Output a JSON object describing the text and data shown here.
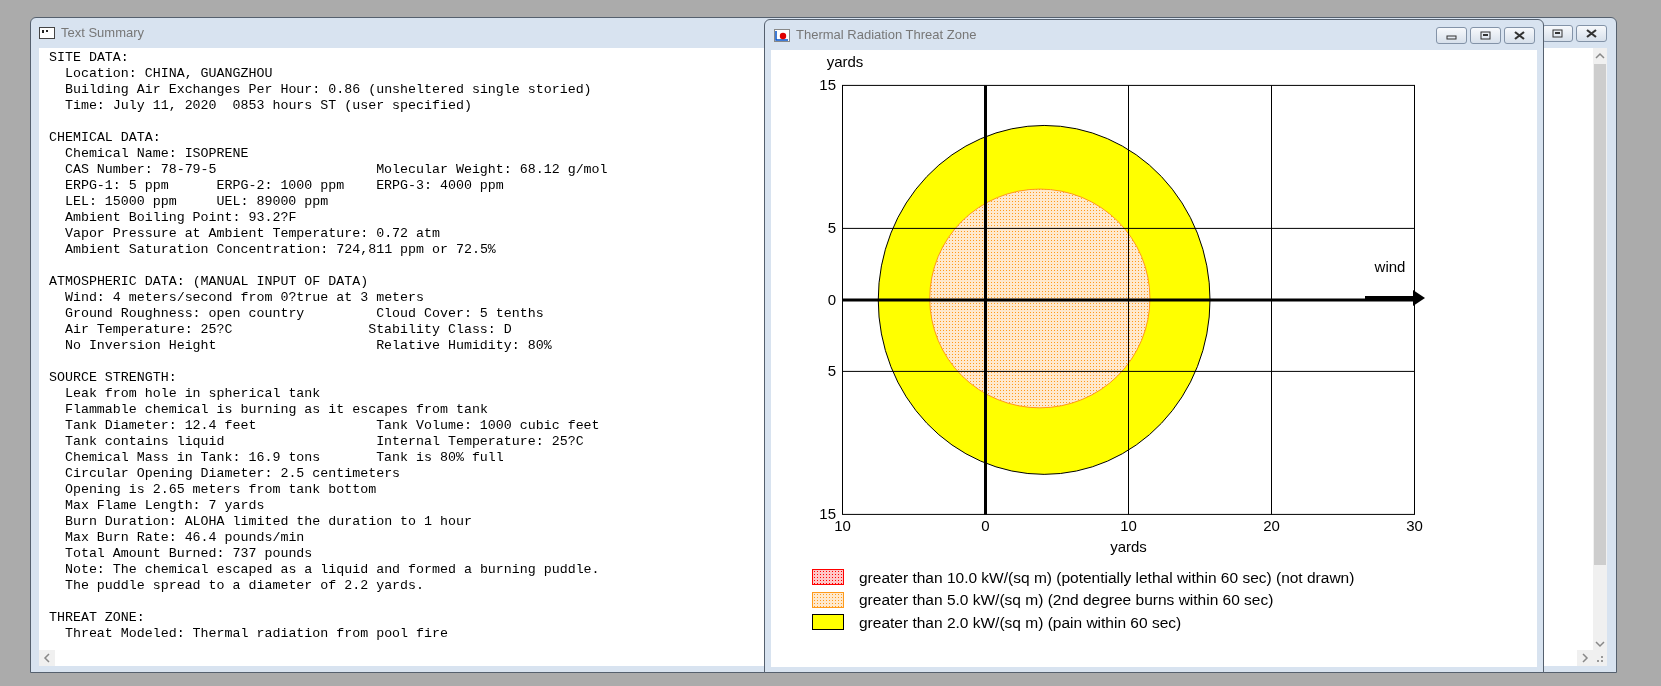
{
  "summary_window": {
    "title": "Text Summary",
    "sections": [
      {
        "heading": "SITE DATA:",
        "lines": [
          {
            "kind": "single",
            "texts": [
              "Location: CHINA, GUANGZHOU"
            ]
          },
          {
            "kind": "single",
            "texts": [
              "Building Air Exchanges Per Hour: 0.86 (unsheltered single storied)"
            ]
          },
          {
            "kind": "single",
            "texts": [
              "Time: July 11, 2020  0853 hours ST (user specified)"
            ]
          }
        ]
      },
      {
        "heading": "CHEMICAL DATA:",
        "lines": [
          {
            "kind": "single",
            "texts": [
              "Chemical Name: ISOPRENE"
            ]
          },
          {
            "kind": "pair",
            "texts": [
              "CAS Number: 78-79-5",
              "Molecular Weight: 68.12 g/mol"
            ]
          },
          {
            "kind": "triple",
            "texts": [
              "ERPG-1: 5 ppm",
              "ERPG-2: 1000 ppm",
              "ERPG-3: 4000 ppm"
            ]
          },
          {
            "kind": "triple",
            "texts": [
              "LEL: 15000 ppm",
              "UEL: 89000 ppm"
            ]
          },
          {
            "kind": "single",
            "texts": [
              "Ambient Boiling Point: 93.2?F"
            ]
          },
          {
            "kind": "single",
            "texts": [
              "Vapor Pressure at Ambient Temperature: 0.72 atm"
            ]
          },
          {
            "kind": "single",
            "texts": [
              "Ambient Saturation Concentration: 724,811 ppm or 72.5%"
            ]
          }
        ]
      },
      {
        "heading": "ATMOSPHERIC DATA: (MANUAL INPUT OF DATA)",
        "lines": [
          {
            "kind": "single",
            "texts": [
              "Wind: 4 meters/second from 0?true at 3 meters"
            ]
          },
          {
            "kind": "pair",
            "texts": [
              "Ground Roughness: open country",
              "Cloud Cover: 5 tenths"
            ]
          },
          {
            "kind": "pair_short",
            "texts": [
              "Air Temperature: 25?C",
              "Stability Class: D"
            ]
          },
          {
            "kind": "pair",
            "texts": [
              "No Inversion Height",
              "Relative Humidity: 80%"
            ]
          }
        ]
      },
      {
        "heading": "SOURCE STRENGTH:",
        "lines": [
          {
            "kind": "single",
            "texts": [
              "Leak from hole in spherical tank"
            ]
          },
          {
            "kind": "single",
            "texts": [
              "Flammable chemical is burning as it escapes from tank"
            ]
          },
          {
            "kind": "pair",
            "texts": [
              "Tank Diameter: 12.4 feet",
              "Tank Volume: 1000 cubic feet"
            ]
          },
          {
            "kind": "pair",
            "texts": [
              "Tank contains liquid",
              "Internal Temperature: 25?C"
            ]
          },
          {
            "kind": "pair",
            "texts": [
              "Chemical Mass in Tank: 16.9 tons",
              "Tank is 80% full"
            ]
          },
          {
            "kind": "single",
            "texts": [
              "Circular Opening Diameter: 2.5 centimeters"
            ]
          },
          {
            "kind": "single",
            "texts": [
              "Opening is 2.65 meters from tank bottom"
            ]
          },
          {
            "kind": "single",
            "texts": [
              "Max Flame Length: 7 yards"
            ]
          },
          {
            "kind": "single",
            "texts": [
              "Burn Duration: ALOHA limited the duration to 1 hour"
            ]
          },
          {
            "kind": "single",
            "texts": [
              "Max Burn Rate: 46.4 pounds/min"
            ]
          },
          {
            "kind": "single",
            "texts": [
              "Total Amount Burned: 737 pounds"
            ]
          },
          {
            "kind": "single",
            "texts": [
              "Note: The chemical escaped as a liquid and formed a burning puddle."
            ]
          },
          {
            "kind": "single",
            "texts": [
              "The puddle spread to a diameter of 2.2 yards."
            ]
          }
        ]
      },
      {
        "heading": "THREAT ZONE:",
        "lines": [
          {
            "kind": "single",
            "texts": [
              "Threat Modeled: Thermal radiation from pool fire"
            ]
          }
        ]
      }
    ]
  },
  "threat_window": {
    "title": "Thermal Radiation Threat Zone",
    "chart": {
      "y_axis_label": "yards",
      "y_ticks": [
        "15",
        "5",
        "0",
        "5",
        "15"
      ],
      "x_ticks": [
        "10",
        "0",
        "10",
        "20",
        "30"
      ],
      "x_axis_label": "yards",
      "wind_label": "wind"
    },
    "legend": [
      {
        "text": "greater than 10.0 kW/(sq m) (potentially lethal within 60 sec) (not drawn)",
        "color": "#ff0000",
        "kind": "dotted",
        "drawn": false
      },
      {
        "text": "greater than 5.0 kW/(sq m) (2nd degree burns within 60 sec)",
        "color": "#ff9a1a",
        "kind": "dotted",
        "drawn": true
      },
      {
        "text": "greater than 2.0 kW/(sq m) (pain within 60 sec)",
        "color": "#ffff00",
        "kind": "solid",
        "drawn": true
      }
    ]
  }
}
